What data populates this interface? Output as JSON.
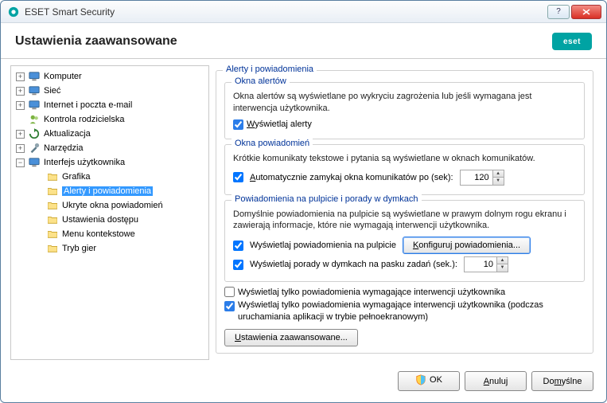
{
  "titlebar": {
    "text": "ESET Smart Security"
  },
  "header": {
    "title": "Ustawienia zaawansowane",
    "logo_text": "eset"
  },
  "tree": {
    "items": [
      {
        "label": "Komputer",
        "expandable": true,
        "icon": "monitor"
      },
      {
        "label": "Sieć",
        "expandable": true,
        "icon": "monitor"
      },
      {
        "label": "Internet i poczta e-mail",
        "expandable": true,
        "icon": "monitor"
      },
      {
        "label": "Kontrola rodzicielska",
        "expandable": false,
        "icon": "people"
      },
      {
        "label": "Aktualizacja",
        "expandable": true,
        "icon": "refresh"
      },
      {
        "label": "Narzędzia",
        "expandable": true,
        "icon": "tools"
      },
      {
        "label": "Interfejs użytkownika",
        "expandable": true,
        "expanded": true,
        "icon": "monitor",
        "children": [
          {
            "label": "Grafika"
          },
          {
            "label": "Alerty i powiadomienia",
            "selected": true
          },
          {
            "label": "Ukryte okna powiadomień"
          },
          {
            "label": "Ustawienia dostępu"
          },
          {
            "label": "Menu kontekstowe"
          },
          {
            "label": "Tryb gier"
          }
        ]
      }
    ]
  },
  "content": {
    "group1": {
      "title": "Alerty i powiadomienia",
      "sub1_title": "Okna alertów",
      "sub1_text": "Okna alertów są wyświetlane po wykryciu zagrożenia lub jeśli wymagana jest interwencja użytkownika.",
      "chk1_label": "Wyświetlaj alerty",
      "sub2_title": "Okna powiadomień",
      "sub2_text": "Krótkie komunikaty tekstowe i pytania są wyświetlane w oknach komunikatów.",
      "chk2_label": "Automatycznie zamykaj okna komunikatów po (sek):",
      "chk2_value": "120",
      "sub3_title": "Powiadomienia na pulpicie i porady w dymkach",
      "sub3_text": "Domyślnie powiadomienia na pulpicie są wyświetlane w prawym dolnym rogu ekranu i zawierają informacje, które nie wymagają interwencji użytkownika.",
      "chk3_label": "Wyświetlaj powiadomienia na pulpicie",
      "btn_configure": "Konfiguruj powiadomienia...",
      "chk4_label": "Wyświetlaj porady w dymkach na pasku zadań (sek.):",
      "chk4_value": "10",
      "chk5_label": "Wyświetlaj tylko powiadomienia wymagające interwencji użytkownika",
      "chk6_label": "Wyświetlaj tylko powiadomienia wymagające interwencji użytkownika (podczas uruchamiania aplikacji w trybie pełnoekranowym)",
      "btn_advanced": "Ustawienia zaawansowane..."
    }
  },
  "footer": {
    "ok": "OK",
    "cancel": "Anuluj",
    "default": "Domyślne"
  }
}
